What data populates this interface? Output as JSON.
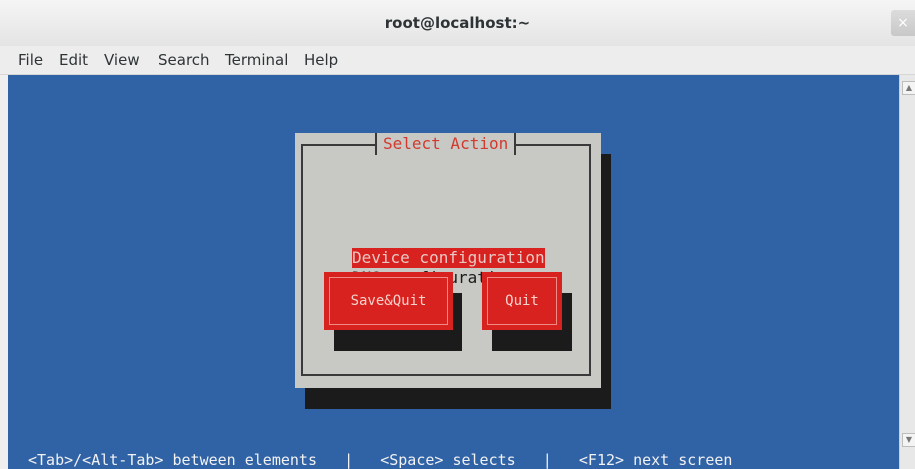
{
  "window": {
    "title": "root@localhost:~",
    "close_glyph": "×"
  },
  "menubar": {
    "items": [
      "File",
      "Edit",
      "View",
      "Search",
      "Terminal",
      "Help"
    ]
  },
  "dialog": {
    "title": "Select Action",
    "items": [
      "Device configuration",
      "DNS configuration"
    ],
    "selected_index": 0,
    "buttons": [
      "Save&Quit",
      "Quit"
    ]
  },
  "statusline": {
    "part1": "<Tab>/<Alt-Tab> between elements",
    "sep1": "|",
    "part2": "<Space> selects",
    "sep2": "|",
    "part3": "<F12> next screen"
  },
  "colors": {
    "terminal_bg": "#3062a6",
    "dialog_bg": "#c8c8c4",
    "accent_red": "#d8221f",
    "shadow": "#1b1b1b"
  }
}
